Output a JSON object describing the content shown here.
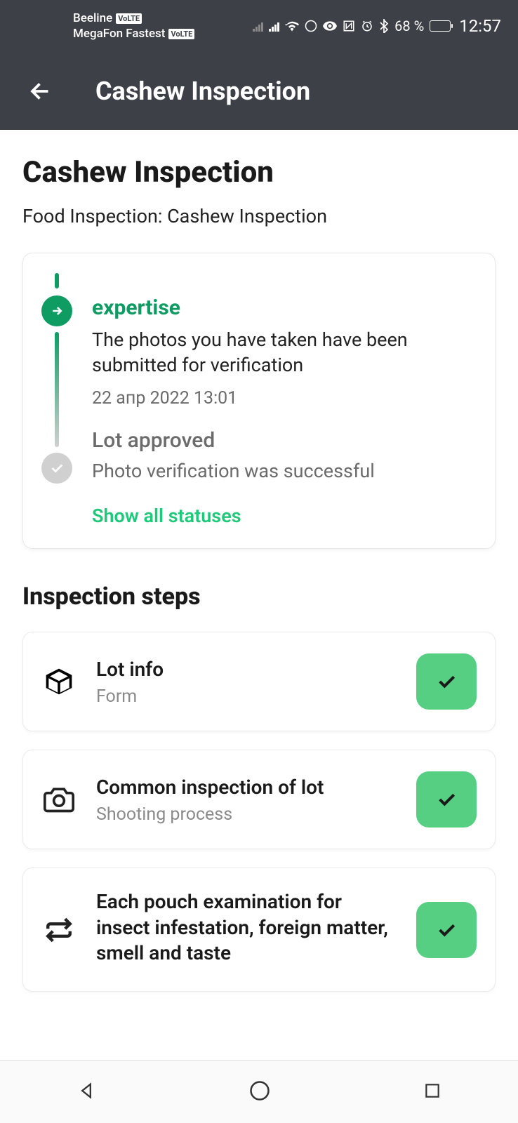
{
  "status_bar": {
    "carrier1": "Beeline",
    "volte1": "VoLTE",
    "carrier2": "MegaFon Fastest",
    "volte2": "VoLTE",
    "battery_pct": "68 %",
    "time": "12:57"
  },
  "app_bar": {
    "title": "Cashew Inspection"
  },
  "page": {
    "title": "Cashew Inspection",
    "subtitle": "Food Inspection: Cashew Inspection",
    "section_title": "Inspection steps"
  },
  "timeline": {
    "item1_title": "expertise",
    "item1_desc": "The photos you have taken have been submitted for verification",
    "item1_date": "22 апр 2022 13:01",
    "item2_title": "Lot approved",
    "item2_desc": "Photo verification was successful",
    "show_all": "Show all statuses"
  },
  "steps": [
    {
      "title": "Lot info",
      "sub": "Form",
      "icon": "box",
      "done": true
    },
    {
      "title": "Common inspection of lot",
      "sub": "Shooting process",
      "icon": "camera",
      "done": true
    },
    {
      "title": "Each pouch examination for insect infestation, foreign matter, smell and taste",
      "sub": "",
      "icon": "repeat",
      "done": true
    }
  ]
}
